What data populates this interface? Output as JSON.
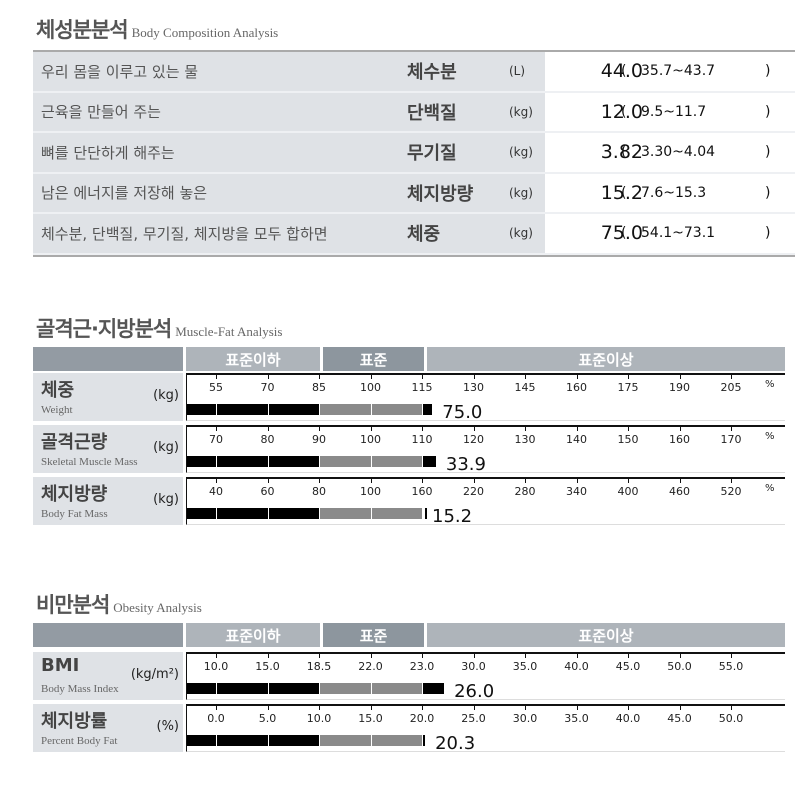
{
  "composition": {
    "title_ko": "체성분분석",
    "title_en": "Body Composition Analysis",
    "rows": [
      {
        "desc": "우리 몸을 이루고 있는 물",
        "name": "체수분",
        "unit": "(L)",
        "value": "44.0",
        "range": "35.7~43.7"
      },
      {
        "desc": "근육을 만들어 주는",
        "name": "단백질",
        "unit": "(kg)",
        "value": "12.0",
        "range": "9.5~11.7"
      },
      {
        "desc": "뼈를 단단하게 해주는",
        "name": "무기질",
        "unit": "(kg)",
        "value": "3.82",
        "range": "3.30~4.04"
      },
      {
        "desc": "남은 에너지를 저장해 놓은",
        "name": "체지방량",
        "unit": "(kg)",
        "value": "15.2",
        "range": "7.6~15.3"
      },
      {
        "desc": "체수분, 단백질, 무기질, 체지방을 모두 합하면",
        "name": "체중",
        "unit": "(kg)",
        "value": "75.0",
        "range": "54.1~73.1"
      }
    ]
  },
  "muscle_fat": {
    "title_ko": "골격근·지방분석",
    "title_en": "Muscle-Fat Analysis",
    "bands": {
      "low": "표준이하",
      "normal": "표준",
      "high": "표준이상"
    },
    "rows": [
      {
        "name_ko": "체중",
        "name_en": "Weight",
        "unit": "(kg)",
        "ticks": [
          "55",
          "70",
          "85",
          "100",
          "115",
          "130",
          "145",
          "160",
          "175",
          "190",
          "205"
        ],
        "tick_unit": "%",
        "value": "75.0",
        "bar_level": 118
      },
      {
        "name_ko": "골격근량",
        "name_en": "Skeletal Muscle Mass",
        "unit": "(kg)",
        "ticks": [
          "70",
          "80",
          "90",
          "100",
          "110",
          "120",
          "130",
          "140",
          "150",
          "160",
          "170"
        ],
        "tick_unit": "%",
        "value": "33.9",
        "bar_level": 112.7
      },
      {
        "name_ko": "체지방량",
        "name_en": "Body Fat Mass",
        "unit": "(kg)",
        "ticks": [
          "40",
          "60",
          "80",
          "100",
          "160",
          "220",
          "280",
          "340",
          "400",
          "460",
          "520"
        ],
        "tick_unit": "%",
        "value": "15.2",
        "bar_level": 160
      }
    ]
  },
  "obesity": {
    "title_ko": "비만분석",
    "title_en": "Obesity Analysis",
    "bands": {
      "low": "표준이하",
      "normal": "표준",
      "high": "표준이상"
    },
    "rows": [
      {
        "name_ko": "BMI",
        "name_en": "Body Mass Index",
        "unit": "(kg/m²)",
        "ticks": [
          "10.0",
          "15.0",
          "18.5",
          "22.0",
          "23.0",
          "30.0",
          "35.0",
          "40.0",
          "45.0",
          "50.0",
          "55.0"
        ],
        "tick_unit": "",
        "value": "26.0",
        "bar_level": 26.0
      },
      {
        "name_ko": "체지방률",
        "name_en": "Percent Body Fat",
        "unit": "(%)",
        "ticks": [
          "0.0",
          "5.0",
          "10.0",
          "15.0",
          "20.0",
          "25.0",
          "30.0",
          "35.0",
          "40.0",
          "45.0",
          "50.0"
        ],
        "tick_unit": "",
        "value": "20.3",
        "bar_level": 20.3
      }
    ]
  }
}
